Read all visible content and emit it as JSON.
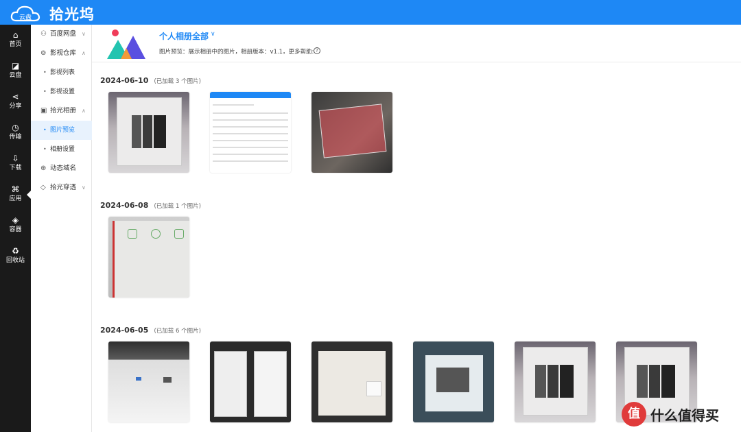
{
  "app": {
    "title": "拾光坞"
  },
  "iconbar": [
    {
      "label": "首页",
      "icon": "home-icon",
      "glyph": "⌂"
    },
    {
      "label": "云盘",
      "icon": "cloud-disk-icon",
      "glyph": "◪"
    },
    {
      "label": "分享",
      "icon": "share-icon",
      "glyph": "⋖"
    },
    {
      "label": "传输",
      "icon": "transfer-icon",
      "glyph": "◷"
    },
    {
      "label": "下载",
      "icon": "download-icon",
      "glyph": "⇩"
    },
    {
      "label": "应用",
      "icon": "apps-icon",
      "glyph": "⌘"
    },
    {
      "label": "容器",
      "icon": "container-icon",
      "glyph": "◈"
    },
    {
      "label": "回收站",
      "icon": "recycle-icon",
      "glyph": "♻"
    }
  ],
  "submenu": {
    "baidu": "百度网盘",
    "media": "影视仓库",
    "media_list": "影视列表",
    "media_settings": "影视设置",
    "album": "拾光相册",
    "album_preview": "图片预览",
    "album_settings": "相册设置",
    "ddns": "动态域名",
    "penetration": "拾光穿透"
  },
  "album": {
    "title": "个人相册全部",
    "description": "图片预览：展示相册中的图片，相册版本：v1.1，更多帮助:"
  },
  "groups": [
    {
      "date": "2024-06-10",
      "count_text": "(已加载 3 个图片)"
    },
    {
      "date": "2024-06-08",
      "count_text": "(已加载 1 个图片)"
    },
    {
      "date": "2024-06-05",
      "count_text": "(已加载 6 个图片)"
    }
  ],
  "watermark": {
    "text": "什么值得买",
    "glyph": "值"
  },
  "colors": {
    "accent": "#1e88f5",
    "sidebar": "#1a1a1a"
  }
}
